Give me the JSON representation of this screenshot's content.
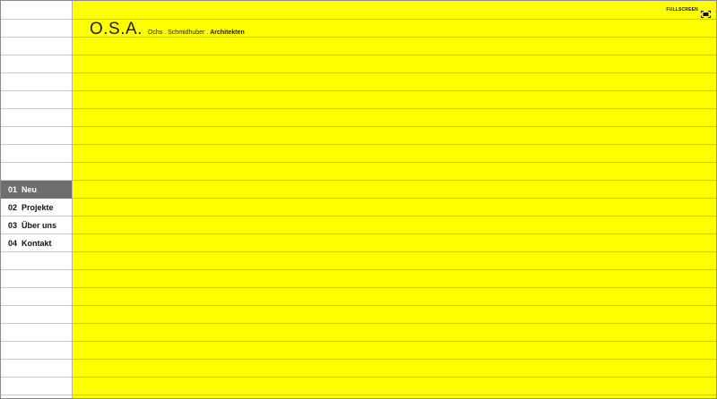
{
  "header": {
    "logo": "O.S.A.",
    "tagline_names": "Ochs . Schmidhuber . ",
    "tagline_strong": "Architekten",
    "fullscreen_label": "FULLSCREEN",
    "fullscreen_icon": "fullscreen-icon"
  },
  "nav": {
    "items": [
      {
        "num": "01",
        "label": "Neu",
        "active": true
      },
      {
        "num": "02",
        "label": "Projekte",
        "active": false
      },
      {
        "num": "03",
        "label": "Über uns",
        "active": false
      },
      {
        "num": "04",
        "label": "Kontakt",
        "active": false
      }
    ]
  },
  "colors": {
    "main_background": "#ffff00",
    "active_nav_background": "#6e6e6e",
    "sidebar_background": "#ffffff"
  }
}
